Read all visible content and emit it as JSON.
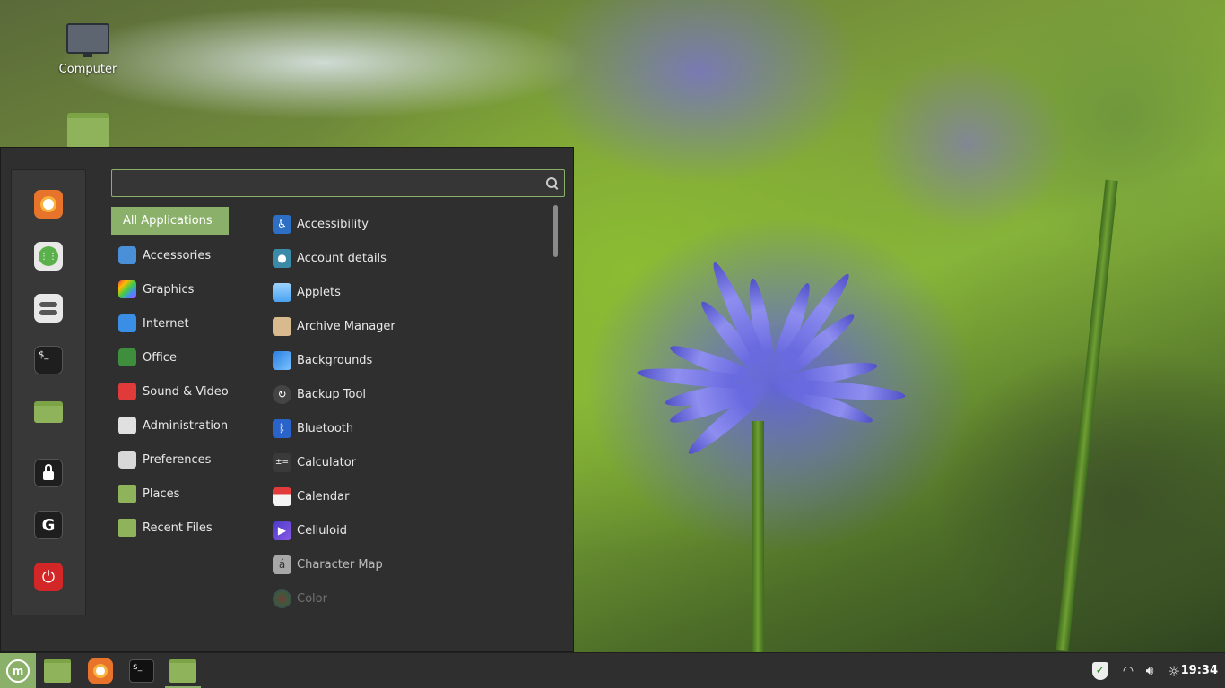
{
  "desktop": {
    "icons": [
      {
        "label": "Computer"
      }
    ]
  },
  "menu": {
    "search": {
      "value": "",
      "placeholder": ""
    },
    "favorites": [
      "firefox",
      "software-manager",
      "system-settings",
      "terminal",
      "files",
      "lock-screen",
      "logout",
      "shutdown"
    ],
    "categories": [
      {
        "label": "All Applications",
        "icon": "all-apps",
        "active": true
      },
      {
        "label": "Accessories",
        "icon": "accessories"
      },
      {
        "label": "Graphics",
        "icon": "graphics"
      },
      {
        "label": "Internet",
        "icon": "internet"
      },
      {
        "label": "Office",
        "icon": "office"
      },
      {
        "label": "Sound & Video",
        "icon": "sound-video"
      },
      {
        "label": "Administration",
        "icon": "administration"
      },
      {
        "label": "Preferences",
        "icon": "preferences"
      },
      {
        "label": "Places",
        "icon": "places"
      },
      {
        "label": "Recent Files",
        "icon": "recent-files"
      }
    ],
    "apps": [
      {
        "label": "Accessibility",
        "icon": "accessibility"
      },
      {
        "label": "Account details",
        "icon": "account"
      },
      {
        "label": "Applets",
        "icon": "applets"
      },
      {
        "label": "Archive Manager",
        "icon": "archive"
      },
      {
        "label": "Backgrounds",
        "icon": "backgrounds"
      },
      {
        "label": "Backup Tool",
        "icon": "backup"
      },
      {
        "label": "Bluetooth",
        "icon": "bluetooth"
      },
      {
        "label": "Calculator",
        "icon": "calculator"
      },
      {
        "label": "Calendar",
        "icon": "calendar"
      },
      {
        "label": "Celluloid",
        "icon": "celluloid"
      },
      {
        "label": "Character Map",
        "icon": "character-map"
      },
      {
        "label": "Color",
        "icon": "color"
      }
    ]
  },
  "panel": {
    "launchers": [
      "files",
      "firefox",
      "terminal",
      "files-open"
    ],
    "tray": [
      "update-shield",
      "wifi",
      "volume",
      "brightness"
    ],
    "clock": "19:34"
  },
  "colors": {
    "accent": "#8ab06a",
    "panel": "#2f2f2f",
    "menu_bg": "#2f2f2f"
  }
}
